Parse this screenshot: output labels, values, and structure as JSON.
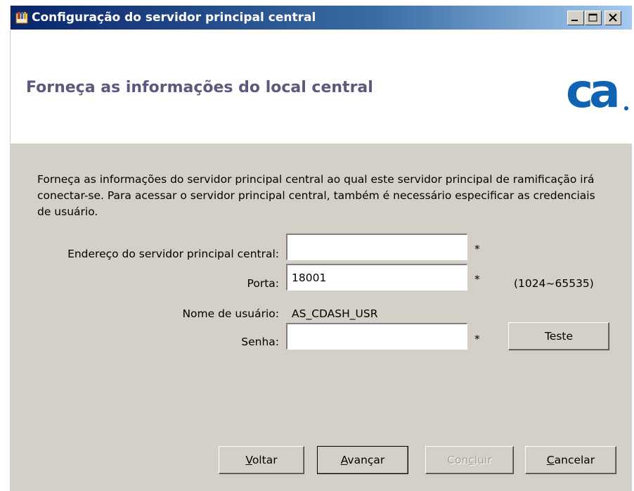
{
  "window": {
    "title": "Configuração do servidor principal central",
    "controls": [
      "minimize-icon",
      "maximize-icon",
      "close-icon"
    ]
  },
  "header": {
    "title": "Forneça as informações do local central",
    "logo": "ca"
  },
  "description": "Forneça as informações do servidor principal central ao qual este servidor principal de ramificação irá conectar-se. Para acessar o servidor principal central, também é necessário especificar as credenciais de usuário.",
  "form": {
    "server_label": "Endereço do servidor principal central:",
    "server_value": "",
    "server_required": "*",
    "port_label": "Porta:",
    "port_value": "18001",
    "port_required": "*",
    "port_range": "(1024~65535)",
    "username_label": "Nome de usuário:",
    "username_value": "AS_CDASH_USR",
    "password_label": "Senha:",
    "password_value": "",
    "password_required": "*",
    "test_button": "Teste"
  },
  "footer": {
    "back": {
      "mnemonic": "V",
      "rest": "oltar"
    },
    "next": {
      "mnemonic": "A",
      "rest": "vançar"
    },
    "finish": {
      "pre": "Con",
      "mnemonic": "c",
      "rest": "luir"
    },
    "cancel": {
      "mnemonic": "C",
      "rest": "ancelar"
    }
  },
  "colors": {
    "titlebar_start": "#0a246a",
    "titlebar_end": "#a6caf0",
    "header_title": "#5b5a7e",
    "logo_blue": "#1062b3",
    "dialog_bg": "#d4d0c8"
  }
}
